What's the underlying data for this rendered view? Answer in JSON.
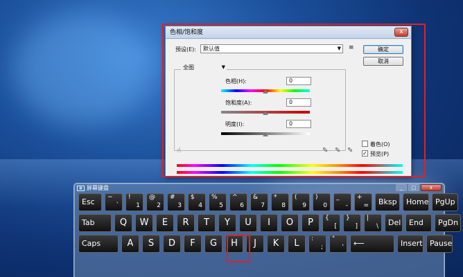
{
  "dialog": {
    "title": "色相/饱和度",
    "close": "x",
    "preset_label": "预设(E):",
    "preset_value": "默认值",
    "menu_icon": "menu-list-icon",
    "ok": "确定",
    "cancel": "取消",
    "channel": "全图",
    "hue_label": "色相(H):",
    "hue_value": "0",
    "saturation_label": "饱和度(A):",
    "saturation_value": "0",
    "lightness_label": "明度(I):",
    "lightness_value": "0",
    "colorize_label": "着色(O)",
    "preview_label": "预览(P)",
    "colorize_checked": false,
    "preview_checked": true
  },
  "keyboard": {
    "title": "屏幕键盘",
    "row1": [
      {
        "label": "Esc"
      },
      {
        "top": "~",
        "bot": "`"
      },
      {
        "top": "!",
        "bot": "1"
      },
      {
        "top": "@",
        "bot": "2"
      },
      {
        "top": "#",
        "bot": "3"
      },
      {
        "top": "$",
        "bot": "4"
      },
      {
        "top": "%",
        "bot": "5"
      },
      {
        "top": "^",
        "bot": "6"
      },
      {
        "top": "&",
        "bot": "7"
      },
      {
        "top": "*",
        "bot": "8"
      },
      {
        "top": "(",
        "bot": "9"
      },
      {
        "top": ")",
        "bot": "0"
      },
      {
        "top": "_",
        "bot": "-"
      },
      {
        "top": "+",
        "bot": "="
      },
      {
        "label": "Bksp"
      },
      {
        "label": "Home"
      },
      {
        "label": "PgUp"
      }
    ],
    "row2": [
      {
        "label": "Tab"
      },
      {
        "label": "Q"
      },
      {
        "label": "W"
      },
      {
        "label": "E"
      },
      {
        "label": "R"
      },
      {
        "label": "T"
      },
      {
        "label": "Y"
      },
      {
        "label": "U"
      },
      {
        "label": "I"
      },
      {
        "label": "O"
      },
      {
        "label": "P"
      },
      {
        "top": "{",
        "bot": "["
      },
      {
        "top": "}",
        "bot": "]"
      },
      {
        "top": "|",
        "bot": "\\"
      },
      {
        "label": "Del"
      },
      {
        "label": "End"
      },
      {
        "label": "PgDn"
      }
    ],
    "row3": [
      {
        "label": "Caps"
      },
      {
        "label": "A"
      },
      {
        "label": "S"
      },
      {
        "label": "D"
      },
      {
        "label": "F"
      },
      {
        "label": "G"
      },
      {
        "label": "H"
      },
      {
        "label": "J"
      },
      {
        "label": "K"
      },
      {
        "label": "L"
      },
      {
        "top": ":",
        "bot": ";"
      },
      {
        "top": "\"",
        "bot": "'"
      },
      {
        "label": "⟵"
      },
      {
        "label": "Insert"
      },
      {
        "label": "Pause"
      }
    ]
  }
}
